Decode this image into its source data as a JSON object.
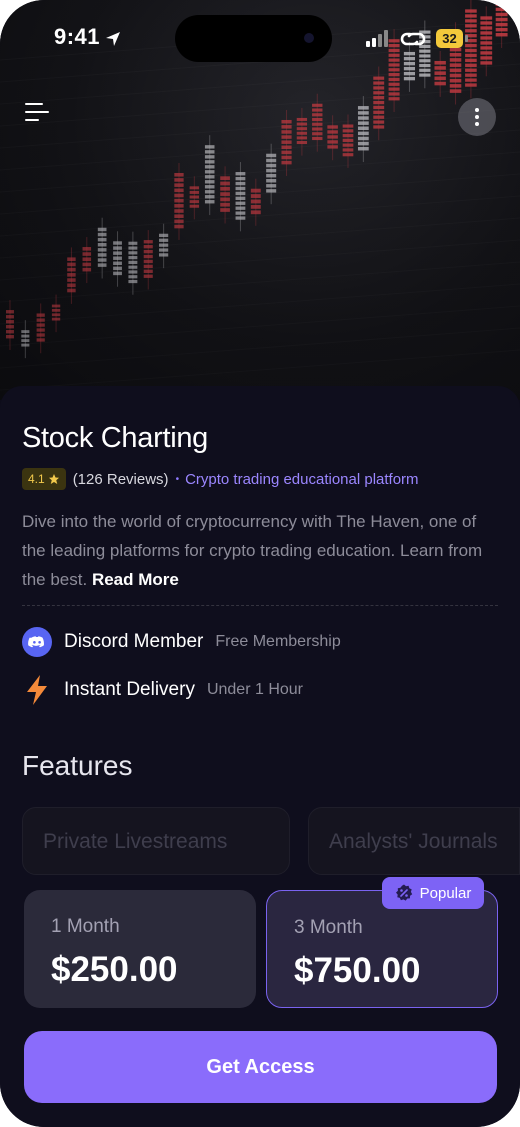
{
  "status_bar": {
    "time": "9:41",
    "battery": "32"
  },
  "colors": {
    "accent": "#8a6cfb",
    "background": "#0f0e1d",
    "rating": "#f2c94c",
    "discord": "#5865f2",
    "delivery": "#f58a3a"
  },
  "product": {
    "title": "Stock Charting",
    "rating": "4.1",
    "reviews": "(126 Reviews)",
    "separator": "•",
    "tagline": "Crypto trading educational platform",
    "description": "Dive into the world of cryptocurrency with The Haven, one of the leading platforms for crypto trading education. Learn from the best. ",
    "read_more": "Read More"
  },
  "info": [
    {
      "icon": "discord-icon",
      "label": "Discord Member",
      "sub": "Free Membership"
    },
    {
      "icon": "lightning-icon",
      "label": "Instant Delivery",
      "sub": "Under 1 Hour"
    }
  ],
  "features": {
    "title": "Features",
    "items": [
      "Private Livestreams",
      "Analysts' Journals"
    ]
  },
  "plans": [
    {
      "name": "1 Month",
      "price": "$250.00",
      "selected": false
    },
    {
      "name": "3 Month",
      "price": "$750.00",
      "selected": true
    }
  ],
  "badge": {
    "icon": "discount-icon",
    "label": "Popular"
  },
  "cta": {
    "label": "Get Access"
  }
}
